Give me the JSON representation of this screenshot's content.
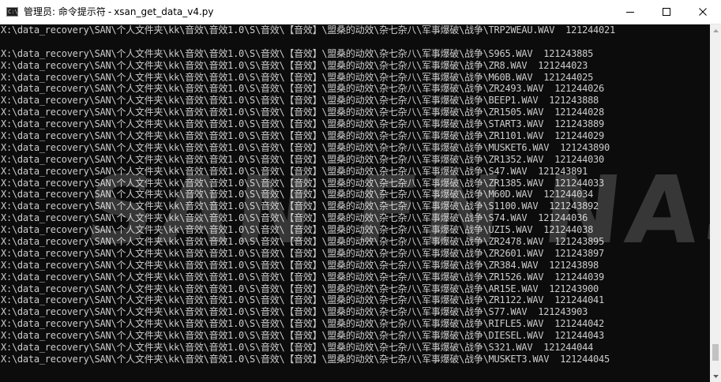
{
  "window": {
    "title_prefix": "管理员: 命令提示符",
    "title_separator": "-",
    "title_script": "xsan_get_data_v4.py",
    "icon_text": "C:\\."
  },
  "controls": {
    "minimize": "minimize",
    "maximize": "maximize",
    "close": "close"
  },
  "console": {
    "lines": [
      "X:\\data_recovery\\SAN\\个人文件夹\\kk\\音效\\音效1.0\\S\\音效\\【音效】\\盟桑的动效\\杂七杂八\\军事爆破\\战争\\TRP2WEAU.WAV  121244021",
      "",
      "X:\\data_recovery\\SAN\\个人文件夹\\kk\\音效\\音效1.0\\S\\音效\\【音效】\\盟桑的动效\\杂七杂八\\军事爆破\\战争\\S965.WAV  121243885",
      "X:\\data_recovery\\SAN\\个人文件夹\\kk\\音效\\音效1.0\\S\\音效\\【音效】\\盟桑的动效\\杂七杂八\\军事爆破\\战争\\ZR8.WAV  121244023",
      "X:\\data_recovery\\SAN\\个人文件夹\\kk\\音效\\音效1.0\\S\\音效\\【音效】\\盟桑的动效\\杂七杂八\\军事爆破\\战争\\M60B.WAV  121244025",
      "X:\\data_recovery\\SAN\\个人文件夹\\kk\\音效\\音效1.0\\S\\音效\\【音效】\\盟桑的动效\\杂七杂八\\军事爆破\\战争\\ZR2493.WAV  121244026",
      "X:\\data_recovery\\SAN\\个人文件夹\\kk\\音效\\音效1.0\\S\\音效\\【音效】\\盟桑的动效\\杂七杂八\\军事爆破\\战争\\BEEP1.WAV  121243888",
      "X:\\data_recovery\\SAN\\个人文件夹\\kk\\音效\\音效1.0\\S\\音效\\【音效】\\盟桑的动效\\杂七杂八\\军事爆破\\战争\\ZR1505.WAV  121244028",
      "X:\\data_recovery\\SAN\\个人文件夹\\kk\\音效\\音效1.0\\S\\音效\\【音效】\\盟桑的动效\\杂七杂八\\军事爆破\\战争\\START3.WAV  121243889",
      "X:\\data_recovery\\SAN\\个人文件夹\\kk\\音效\\音效1.0\\S\\音效\\【音效】\\盟桑的动效\\杂七杂八\\军事爆破\\战争\\ZR1101.WAV  121244029",
      "X:\\data_recovery\\SAN\\个人文件夹\\kk\\音效\\音效1.0\\S\\音效\\【音效】\\盟桑的动效\\杂七杂八\\军事爆破\\战争\\MUSKET6.WAV  121243890",
      "X:\\data_recovery\\SAN\\个人文件夹\\kk\\音效\\音效1.0\\S\\音效\\【音效】\\盟桑的动效\\杂七杂八\\军事爆破\\战争\\ZR1352.WAV  121244030",
      "X:\\data_recovery\\SAN\\个人文件夹\\kk\\音效\\音效1.0\\S\\音效\\【音效】\\盟桑的动效\\杂七杂八\\军事爆破\\战争\\S47.WAV  121243891",
      "X:\\data_recovery\\SAN\\个人文件夹\\kk\\音效\\音效1.0\\S\\音效\\【音效】\\盟桑的动效\\杂七杂八\\军事爆破\\战争\\ZR1385.WAV  121244033",
      "X:\\data_recovery\\SAN\\个人文件夹\\kk\\音效\\音效1.0\\S\\音效\\【音效】\\盟桑的动效\\杂七杂八\\军事爆破\\战争\\M60D.WAV  121244034",
      "X:\\data_recovery\\SAN\\个人文件夹\\kk\\音效\\音效1.0\\S\\音效\\【音效】\\盟桑的动效\\杂七杂八\\军事爆破\\战争\\S1100.WAV  121243892",
      "X:\\data_recovery\\SAN\\个人文件夹\\kk\\音效\\音效1.0\\S\\音效\\【音效】\\盟桑的动效\\杂七杂八\\军事爆破\\战争\\S74.WAV  121244036",
      "X:\\data_recovery\\SAN\\个人文件夹\\kk\\音效\\音效1.0\\S\\音效\\【音效】\\盟桑的动效\\杂七杂八\\军事爆破\\战争\\UZI5.WAV  121244038",
      "X:\\data_recovery\\SAN\\个人文件夹\\kk\\音效\\音效1.0\\S\\音效\\【音效】\\盟桑的动效\\杂七杂八\\军事爆破\\战争\\ZR2478.WAV  121243895",
      "X:\\data_recovery\\SAN\\个人文件夹\\kk\\音效\\音效1.0\\S\\音效\\【音效】\\盟桑的动效\\杂七杂八\\军事爆破\\战争\\ZR2601.WAV  121243897",
      "X:\\data_recovery\\SAN\\个人文件夹\\kk\\音效\\音效1.0\\S\\音效\\【音效】\\盟桑的动效\\杂七杂八\\军事爆破\\战争\\ZR384.WAV  121243898",
      "X:\\data_recovery\\SAN\\个人文件夹\\kk\\音效\\音效1.0\\S\\音效\\【音效】\\盟桑的动效\\杂七杂八\\军事爆破\\战争\\ZR1526.WAV  121244039",
      "X:\\data_recovery\\SAN\\个人文件夹\\kk\\音效\\音效1.0\\S\\音效\\【音效】\\盟桑的动效\\杂七杂八\\军事爆破\\战争\\AR15E.WAV  121243900",
      "X:\\data_recovery\\SAN\\个人文件夹\\kk\\音效\\音效1.0\\S\\音效\\【音效】\\盟桑的动效\\杂七杂八\\军事爆破\\战争\\ZR1122.WAV  121244041",
      "X:\\data_recovery\\SAN\\个人文件夹\\kk\\音效\\音效1.0\\S\\音效\\【音效】\\盟桑的动效\\杂七杂八\\军事爆破\\战争\\S77.WAV  121243903",
      "X:\\data_recovery\\SAN\\个人文件夹\\kk\\音效\\音效1.0\\S\\音效\\【音效】\\盟桑的动效\\杂七杂八\\军事爆破\\战争\\RIFLE5.WAV  121244042",
      "X:\\data_recovery\\SAN\\个人文件夹\\kk\\音效\\音效1.0\\S\\音效\\【音效】\\盟桑的动效\\杂七杂八\\军事爆破\\战争\\DIESEL.WAV  121244043",
      "X:\\data_recovery\\SAN\\个人文件夹\\kk\\音效\\音效1.0\\S\\音效\\【音效】\\盟桑的动效\\杂七杂八\\军事爆破\\战争\\S321.WAV  121244044",
      "X:\\data_recovery\\SAN\\个人文件夹\\kk\\音效\\音效1.0\\S\\音效\\【音效】\\盟桑的动效\\杂七杂八\\军事爆破\\战争\\MUSKET3.WAV  121244045"
    ]
  },
  "scrollbar": {
    "position_fraction": 0.97,
    "visible_fraction": 0.05
  },
  "colors": {
    "console_background": "#0c0c0c",
    "console_text": "#cccccc",
    "titlebar_background": "#ffffff"
  }
}
